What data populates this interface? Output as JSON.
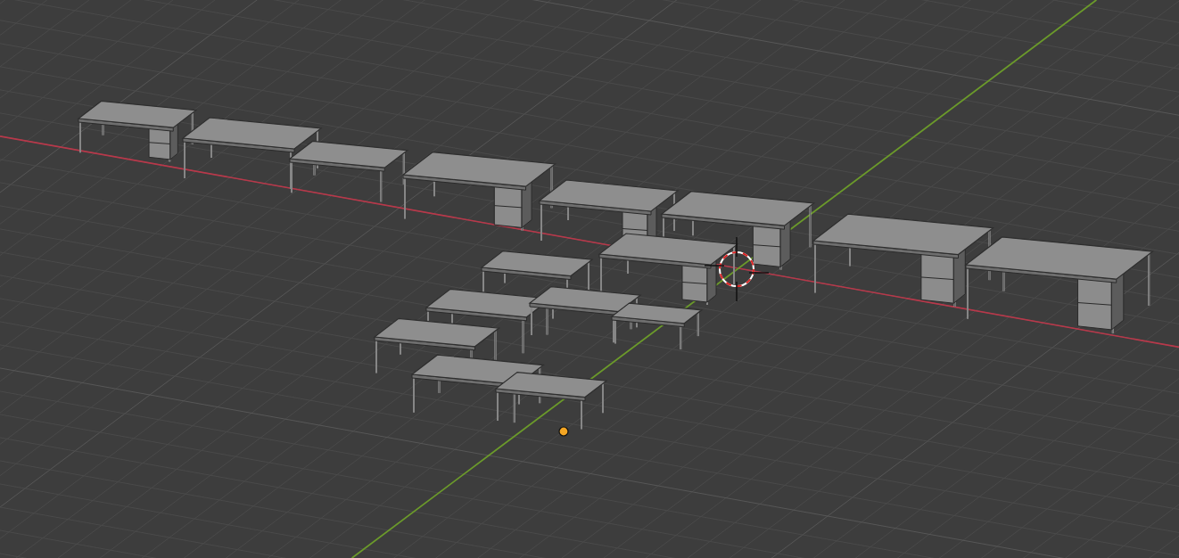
{
  "viewport": {
    "show_grid": true,
    "show_x_axis": true,
    "show_y_axis": true,
    "show_3d_cursor": true,
    "show_origin": true
  }
}
